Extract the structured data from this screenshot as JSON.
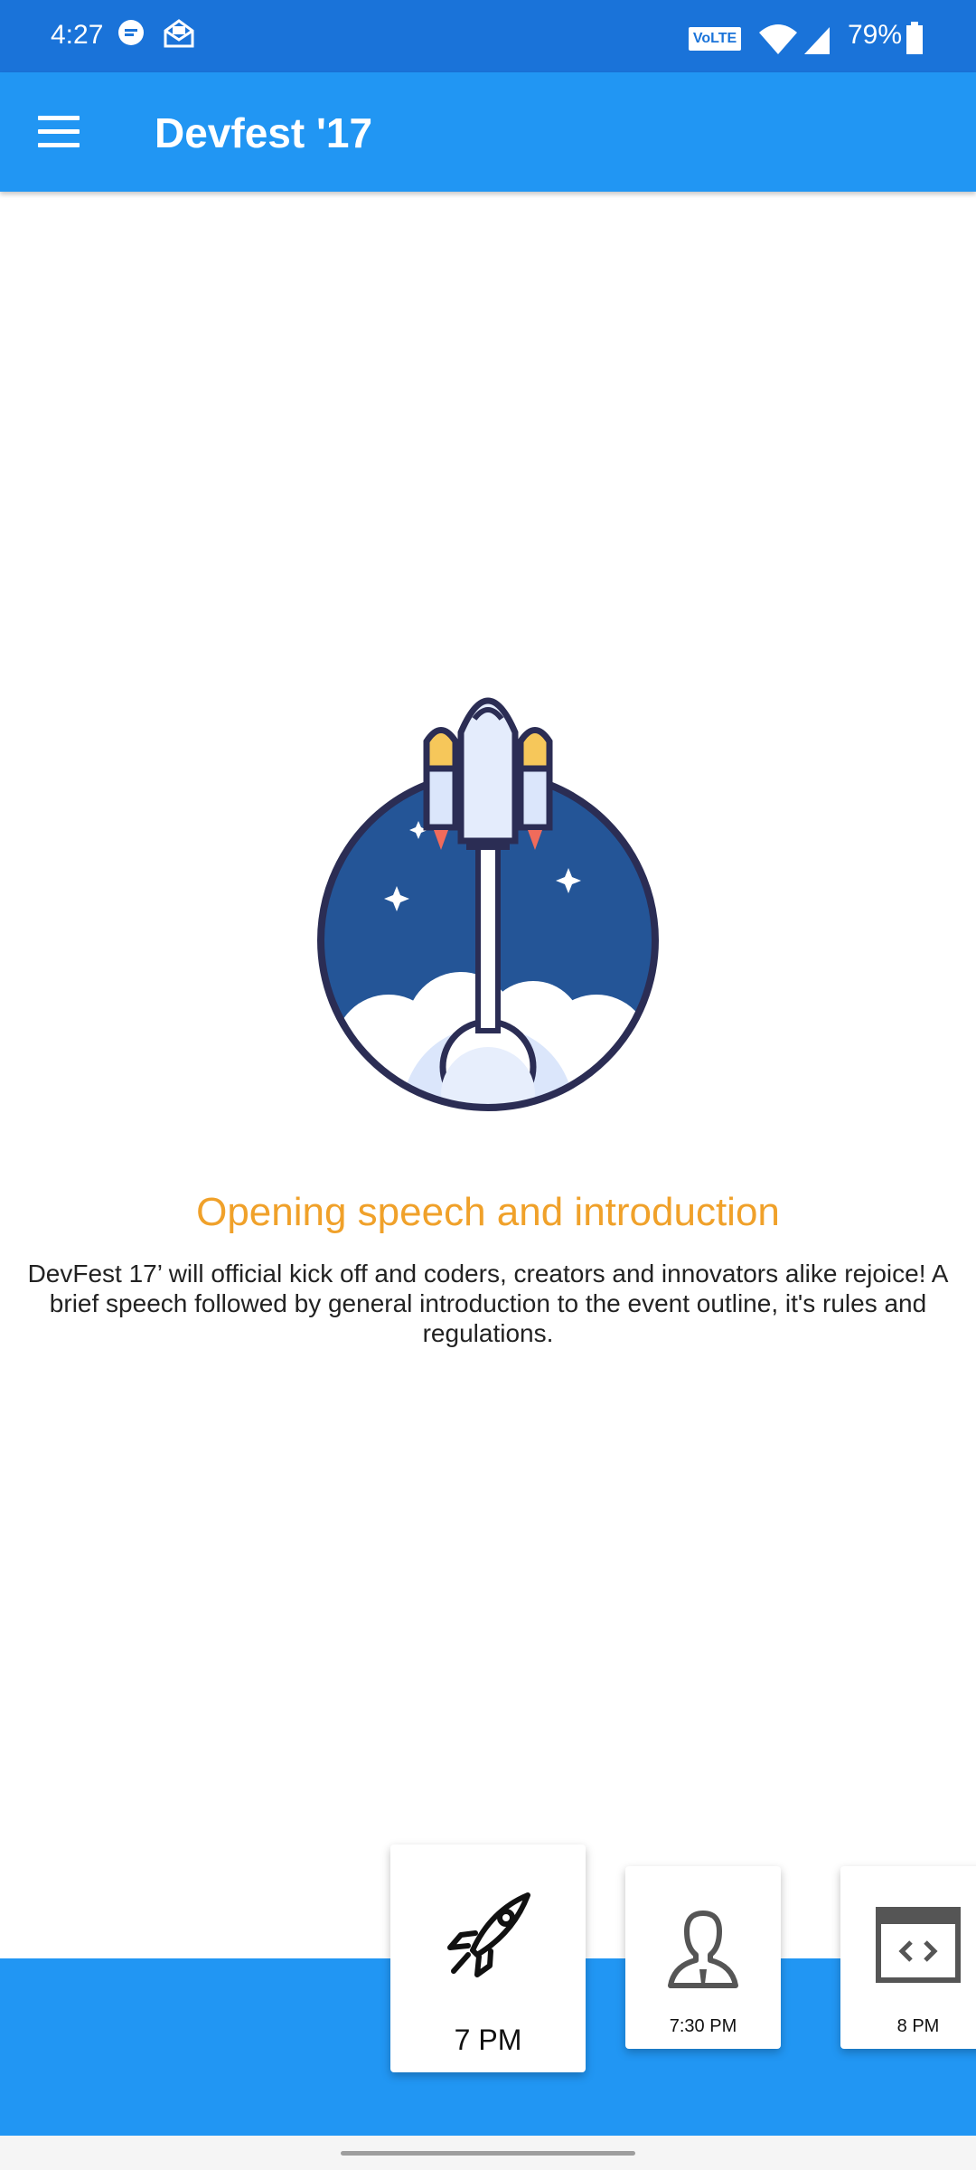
{
  "status_bar": {
    "time": "4:27",
    "volte": "VoLTE",
    "battery": "79%"
  },
  "app_bar": {
    "title": "Devfest '17"
  },
  "session": {
    "title": "Opening speech and introduction",
    "description": "DevFest 17’ will official kick off and coders, creators and innovators alike rejoice! A brief speech followed by general introduction to the event outline, it's rules and regulations."
  },
  "timeline": [
    {
      "time": "7 PM",
      "icon": "rocket-icon",
      "selected": true
    },
    {
      "time": "7:30 PM",
      "icon": "person-icon",
      "selected": false
    },
    {
      "time": "8 PM",
      "icon": "code-window-icon",
      "selected": false
    }
  ],
  "colors": {
    "status_bar": "#1a73d9",
    "primary": "#2196f3",
    "accent": "#f0a12a"
  }
}
